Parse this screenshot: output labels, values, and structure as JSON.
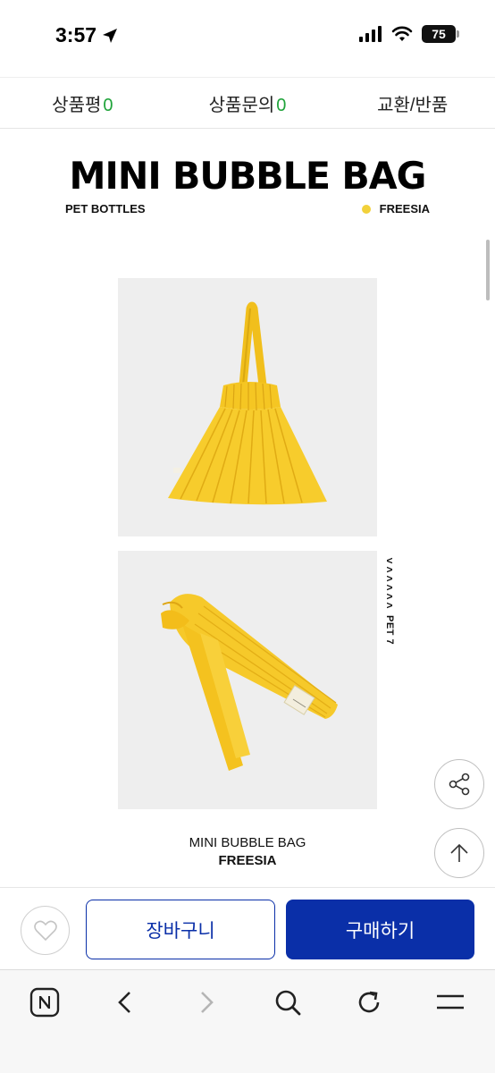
{
  "status_bar": {
    "time": "3:57",
    "battery": "75"
  },
  "tabs": [
    {
      "label": "상품평",
      "count": "0"
    },
    {
      "label": "상품문의",
      "count": "0"
    },
    {
      "label": "교환/반품",
      "count": ""
    }
  ],
  "product": {
    "title": "MINI BUBBLE BAG",
    "material": "PET BOTTLES",
    "color_name": "FREESIA",
    "color_hex": "#f2d13a",
    "pet_label": "PET 7"
  },
  "caption": {
    "line1": "MINI BUBBLE BAG",
    "line2": "FREESIA"
  },
  "actions": {
    "cart_label": "장바구니",
    "buy_label": "구매하기"
  },
  "colors": {
    "accent": "#0a2fa8",
    "count_green": "#1fa33a",
    "bag_yellow": "#f5c520"
  },
  "browser_toolbar": [
    "naver-home-icon",
    "back-icon",
    "forward-icon",
    "search-icon",
    "refresh-icon",
    "menu-icon"
  ]
}
